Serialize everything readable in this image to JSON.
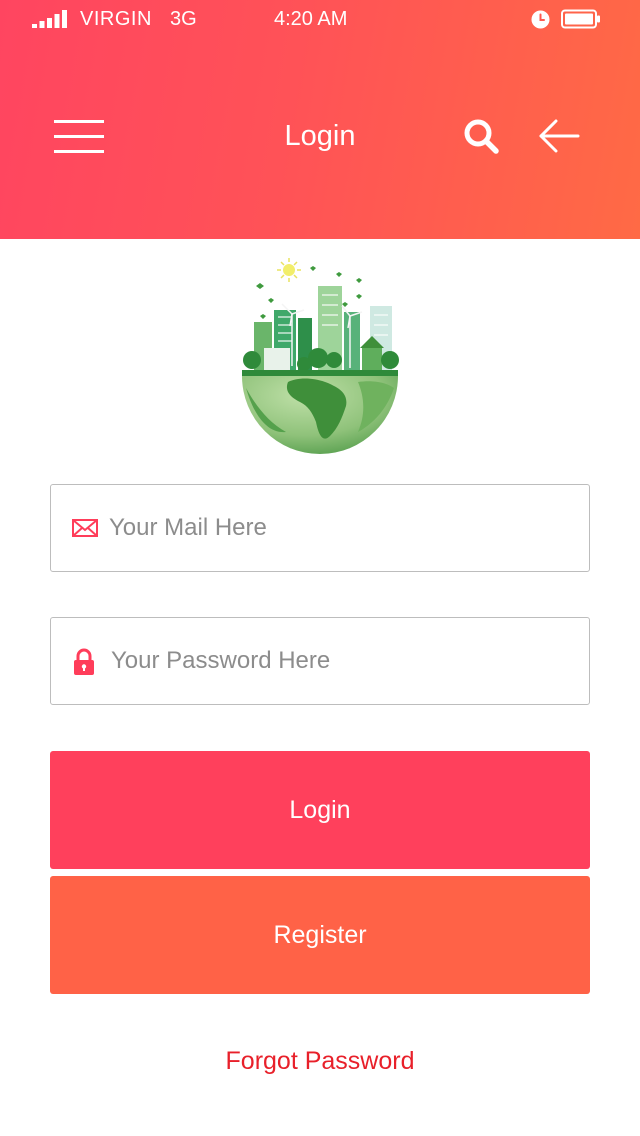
{
  "status_bar": {
    "carrier": "VIRGIN",
    "network": "3G",
    "time": "4:20 AM",
    "signal_icon": "signal-bars-icon",
    "alarm_icon": "alarm-clock-icon",
    "battery_icon": "battery-icon"
  },
  "header": {
    "title": "Login",
    "menu_icon": "hamburger-menu-icon",
    "search_icon": "search-icon",
    "back_icon": "back-arrow-icon"
  },
  "logo": {
    "icon": "green-city-globe-logo"
  },
  "form": {
    "email_placeholder": "Your Mail Here",
    "email_value": "",
    "email_icon": "mail-icon",
    "password_placeholder": "Your Password Here",
    "password_value": "",
    "password_icon": "lock-icon",
    "login_label": "Login",
    "register_label": "Register",
    "forgot_label": "Forgot Password"
  },
  "colors": {
    "header_gradient_start": "#ff4560",
    "header_gradient_end": "#ff6a45",
    "login_button": "#ff405c",
    "register_button": "#ff6247",
    "forgot_link": "#e8202a",
    "icon_accent": "#ff3d5a"
  }
}
